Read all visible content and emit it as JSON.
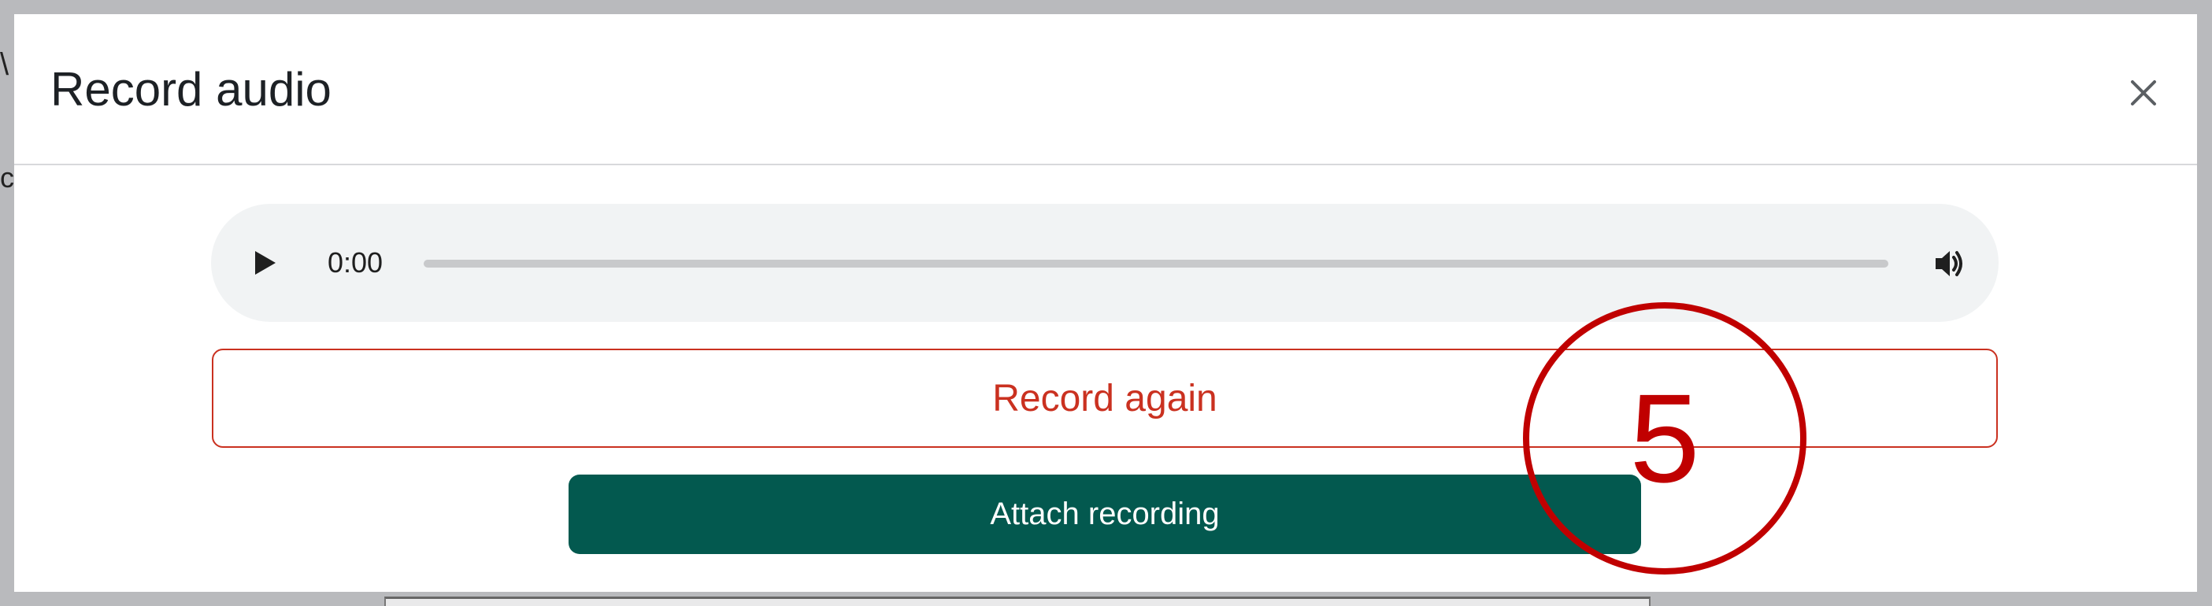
{
  "dialog": {
    "title": "Record audio",
    "close_icon": "close-icon"
  },
  "player": {
    "time": "0:00",
    "progress_fraction": 0,
    "play_icon": "play-icon",
    "volume_icon": "volume-icon"
  },
  "buttons": {
    "record_again": "Record again",
    "attach_recording": "Attach recording"
  },
  "annotation": {
    "number": "5",
    "color": "#c00000"
  },
  "colors": {
    "danger": "#ca3120",
    "primary": "#03594f",
    "player_bg": "#f1f3f4"
  }
}
